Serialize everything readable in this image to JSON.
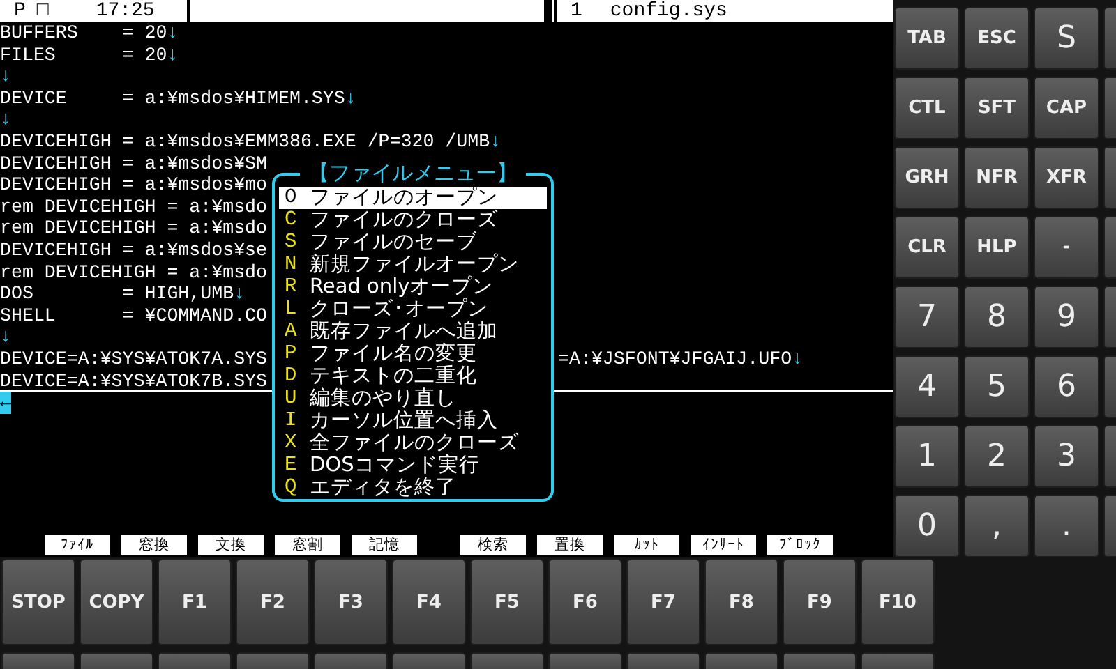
{
  "status_bar": {
    "mode": "P",
    "indicator": "□",
    "time": "17:25",
    "window_number": "1",
    "filename": "config.sys"
  },
  "editor": {
    "lines": [
      {
        "text": "BUFFERS    = 20",
        "eol": "↓"
      },
      {
        "text": "FILES      = 20",
        "eol": "↓"
      },
      {
        "eol": "↓"
      },
      {
        "text": "DEVICE     = a:¥msdos¥HIMEM.SYS",
        "eol": "↓"
      },
      {
        "eol": "↓"
      },
      {
        "text": "DEVICEHIGH = a:¥msdos¥EMM386.EXE /P=320 /UMB",
        "eol": "↓"
      },
      {
        "text": "DEVICEHIGH = a:¥msdos¥SM"
      },
      {
        "text": "DEVICEHIGH = a:¥msdos¥mo"
      },
      {
        "text": "rem DEVICEHIGH = a:¥msdo"
      },
      {
        "text": "rem DEVICEHIGH = a:¥msdo"
      },
      {
        "text": "DEVICEHIGH = a:¥msdos¥se"
      },
      {
        "text": "rem DEVICEHIGH = a:¥msdo"
      },
      {
        "text": "DOS        = HIGH,UMB",
        "eol": "↓"
      },
      {
        "text": "SHELL      = ¥COMMAND.CO"
      },
      {
        "eol": "↓"
      },
      {
        "text": "DEVICE=A:¥SYS¥ATOK7A.SYS",
        "right_text": "=A:¥JSFONT¥JFGAIJ.UFO",
        "eol": "↓"
      },
      {
        "text": "DEVICE=A:¥SYS¥ATOK7B.SYS",
        "current": true
      },
      {
        "cursor": "←"
      }
    ]
  },
  "file_menu": {
    "title": "【ファイルメニュー】",
    "items": [
      {
        "key": "O",
        "label": "ファイルのオープン",
        "selected": true
      },
      {
        "key": "C",
        "label": "ファイルのクローズ",
        "selected": false
      },
      {
        "key": "S",
        "label": "ファイルのセーブ",
        "selected": false
      },
      {
        "key": "N",
        "label": "新規ファイルオープン",
        "selected": false
      },
      {
        "key": "R",
        "label": "Read onlyオープン",
        "selected": false
      },
      {
        "key": "L",
        "label": "クローズ･オープン",
        "selected": false
      },
      {
        "key": "A",
        "label": "既存ファイルへ追加",
        "selected": false
      },
      {
        "key": "P",
        "label": "ファイル名の変更",
        "selected": false
      },
      {
        "key": "D",
        "label": "テキストの二重化",
        "selected": false
      },
      {
        "key": "U",
        "label": "編集のやり直し",
        "selected": false
      },
      {
        "key": "I",
        "label": "カーソル位置へ挿入",
        "selected": false
      },
      {
        "key": "X",
        "label": "全ファイルのクローズ",
        "selected": false
      },
      {
        "key": "E",
        "label": "DOSコマンド実行",
        "selected": false
      },
      {
        "key": "Q",
        "label": "エディタを終了",
        "selected": false
      }
    ]
  },
  "function_labels": [
    "ﾌｧｲﾙ",
    "窓換",
    "文換",
    "窓割",
    "記憶",
    "検索",
    "置換",
    "ｶｯﾄ",
    "ｲﾝｻｰﾄ",
    "ﾌﾞﾛｯｸ"
  ],
  "keypad": [
    {
      "label": "TAB",
      "kind": "command"
    },
    {
      "label": "ESC",
      "kind": "command"
    },
    {
      "label": "S",
      "kind": "char"
    },
    {
      "label": "CTL",
      "kind": "command"
    },
    {
      "label": "SFT",
      "kind": "command"
    },
    {
      "label": "CAP",
      "kind": "command"
    },
    {
      "label": "GRH",
      "kind": "command"
    },
    {
      "label": "NFR",
      "kind": "command"
    },
    {
      "label": "XFR",
      "kind": "command"
    },
    {
      "label": "CLR",
      "kind": "command"
    },
    {
      "label": "HLP",
      "kind": "command"
    },
    {
      "label": "-",
      "kind": "command"
    },
    {
      "label": "7",
      "kind": "char"
    },
    {
      "label": "8",
      "kind": "char"
    },
    {
      "label": "9",
      "kind": "char"
    },
    {
      "label": "4",
      "kind": "char"
    },
    {
      "label": "5",
      "kind": "char"
    },
    {
      "label": "6",
      "kind": "char"
    },
    {
      "label": "1",
      "kind": "char"
    },
    {
      "label": "2",
      "kind": "char"
    },
    {
      "label": "3",
      "kind": "char"
    },
    {
      "label": "0",
      "kind": "char"
    },
    {
      "label": ",",
      "kind": "char"
    },
    {
      "label": ".",
      "kind": "char"
    }
  ],
  "function_keys": [
    "STOP",
    "COPY",
    "F1",
    "F2",
    "F3",
    "F4",
    "F5",
    "F6",
    "F7",
    "F8",
    "F9",
    "F10"
  ]
}
